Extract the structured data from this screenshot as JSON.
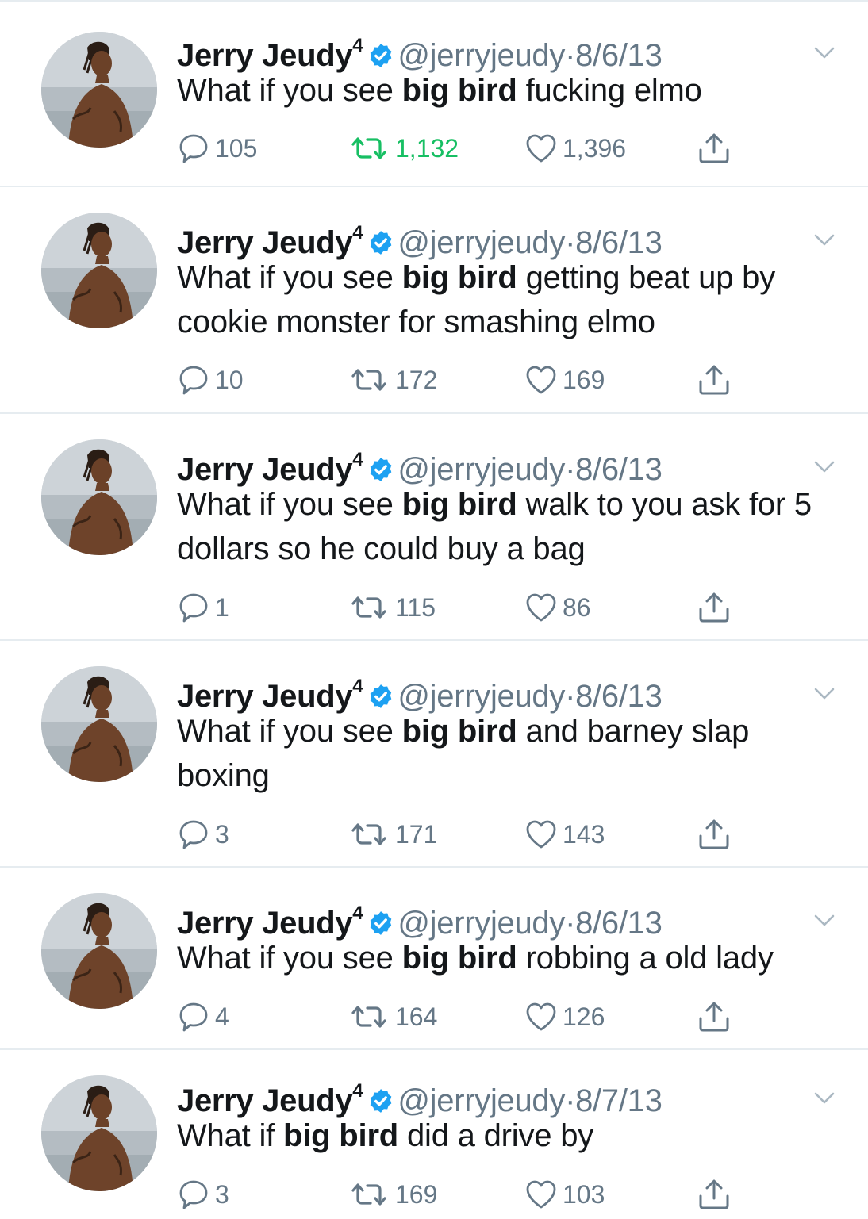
{
  "tweets": [
    {
      "name": "Jerry Jeudy",
      "name_sup": "4",
      "handle": "@jerryjeudy",
      "date": "8/6/13",
      "text_before": "What if you see ",
      "text_bold": "big bird",
      "text_after": " fucking elmo",
      "replies": "105",
      "retweets": "1,132",
      "likes": "1,396",
      "retweeted": true
    },
    {
      "name": "Jerry Jeudy",
      "name_sup": "4",
      "handle": "@jerryjeudy",
      "date": "8/6/13",
      "text_before": "What if you see ",
      "text_bold": "big bird",
      "text_after": " getting beat up by cookie monster for smashing elmo",
      "replies": "10",
      "retweets": "172",
      "likes": "169",
      "retweeted": false
    },
    {
      "name": "Jerry Jeudy",
      "name_sup": "4",
      "handle": "@jerryjeudy",
      "date": "8/6/13",
      "text_before": "What if you see ",
      "text_bold": "big bird",
      "text_after": " walk to you ask for 5 dollars so he could buy a bag",
      "replies": "1",
      "retweets": "115",
      "likes": "86",
      "retweeted": false
    },
    {
      "name": "Jerry Jeudy",
      "name_sup": "4",
      "handle": "@jerryjeudy",
      "date": "8/6/13",
      "text_before": "What if you see ",
      "text_bold": "big bird",
      "text_after": " and barney slap boxing",
      "replies": "3",
      "retweets": "171",
      "likes": "143",
      "retweeted": false
    },
    {
      "name": "Jerry Jeudy",
      "name_sup": "4",
      "handle": "@jerryjeudy",
      "date": "8/6/13",
      "text_before": "What if you see ",
      "text_bold": "big bird",
      "text_after": " robbing a old lady",
      "replies": "4",
      "retweets": "164",
      "likes": "126",
      "retweeted": false
    },
    {
      "name": "Jerry Jeudy",
      "name_sup": "4",
      "handle": "@jerryjeudy",
      "date": "8/7/13",
      "text_before": "What if ",
      "text_bold": "big bird",
      "text_after": " did a drive by",
      "replies": "3",
      "retweets": "169",
      "likes": "103",
      "retweeted": false
    }
  ],
  "separator": "·",
  "icons": {
    "verified": "verified-badge-icon",
    "caret": "chevron-down-icon",
    "reply": "reply-bubble-icon",
    "retweet": "retweet-icon",
    "like": "heart-icon",
    "share": "share-upload-icon"
  },
  "colors": {
    "verified": "#1da1f2",
    "retweet_active": "#17bf63",
    "muted": "#657786",
    "text": "#14171a",
    "divider": "#e6ecf0"
  }
}
